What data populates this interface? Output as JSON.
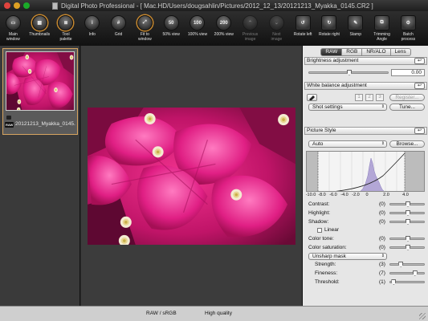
{
  "window": {
    "title": "Digital Photo Professional - [ Mac.HD/Users/dougsahlin/Pictures/2012_12_13/20121213_Myakka_0145.CR2 ]"
  },
  "toolbar": [
    {
      "label": "Main\nwindow",
      "icon": "main-window-icon"
    },
    {
      "label": "Thumbnails",
      "icon": "thumbnails-icon",
      "active": true
    },
    {
      "label": "Tool\npalette",
      "icon": "tool-palette-icon",
      "active": true
    },
    {
      "label": "Info",
      "icon": "info-icon"
    },
    {
      "label": "Grid",
      "icon": "grid-icon"
    },
    {
      "label": "Fit to\nwindow",
      "icon": "fit-to-window-icon",
      "active": true
    },
    {
      "label": "50% view",
      "icon": "zoom-50-icon",
      "glyph": "50"
    },
    {
      "label": "100% view",
      "icon": "zoom-100-icon",
      "glyph": "100"
    },
    {
      "label": "200% view",
      "icon": "zoom-200-icon",
      "glyph": "200"
    },
    {
      "label": "Previous\nimage",
      "icon": "previous-image-icon",
      "disabled": true
    },
    {
      "label": "Next\nimage",
      "icon": "next-image-icon",
      "disabled": true
    },
    {
      "label": "Rotate left",
      "icon": "rotate-left-icon"
    },
    {
      "label": "Rotate right",
      "icon": "rotate-right-icon"
    },
    {
      "label": "Stamp",
      "icon": "stamp-icon"
    },
    {
      "label": "Trimming\nAngle",
      "icon": "trimming-angle-icon"
    },
    {
      "label": "Batch\nprocess",
      "icon": "batch-process-icon"
    }
  ],
  "thumbnail": {
    "filename": "20121213_Myakka_0145.CR2",
    "badge": "RAW"
  },
  "palette": {
    "tabs": [
      "RAW",
      "RGB",
      "NR/ALO",
      "Lens"
    ],
    "active_tab": "RAW",
    "brightness": {
      "title": "Brightness adjustment",
      "value": "0.00",
      "level": 0.5
    },
    "white_balance": {
      "title": "White balance adjustment",
      "custom_nums": [
        "1",
        "2",
        "3"
      ],
      "register_label": "Register...",
      "select_value": "Shot settings",
      "tune_label": "Tune..."
    },
    "picture_style": {
      "title": "Picture Style",
      "select_value": "Auto",
      "browse_label": "Browse...",
      "axis": [
        "-10.0",
        "-8.0",
        "-6.0",
        "-4.0",
        "-2.0",
        "0",
        "2.0",
        "4.0"
      ],
      "rows": [
        {
          "label": "Contrast:",
          "value": "(0)",
          "level": 0.5
        },
        {
          "label": "Highlight:",
          "value": "(0)",
          "level": 0.5
        },
        {
          "label": "Shadow:",
          "value": "(0)",
          "level": 0.5
        }
      ],
      "linear_label": "Linear",
      "rows2": [
        {
          "label": "Color tone:",
          "value": "(0)",
          "level": 0.5
        },
        {
          "label": "Color saturation:",
          "value": "(0)",
          "level": 0.5
        }
      ],
      "sharpen_select": "Unsharp mask",
      "sharpen_rows": [
        {
          "label": "Strength:",
          "value": "(3)",
          "level": 0.3
        },
        {
          "label": "Fineness:",
          "value": "(7)",
          "level": 0.7
        },
        {
          "label": "Threshold:",
          "value": "(1)",
          "level": 0.1
        }
      ]
    }
  },
  "status": {
    "left": "RAW / sRGB",
    "right": "High quality"
  },
  "colors": {
    "accent": "#d7a560",
    "background": "#3c3c3c",
    "palette_bg": "#e6e6e6"
  }
}
